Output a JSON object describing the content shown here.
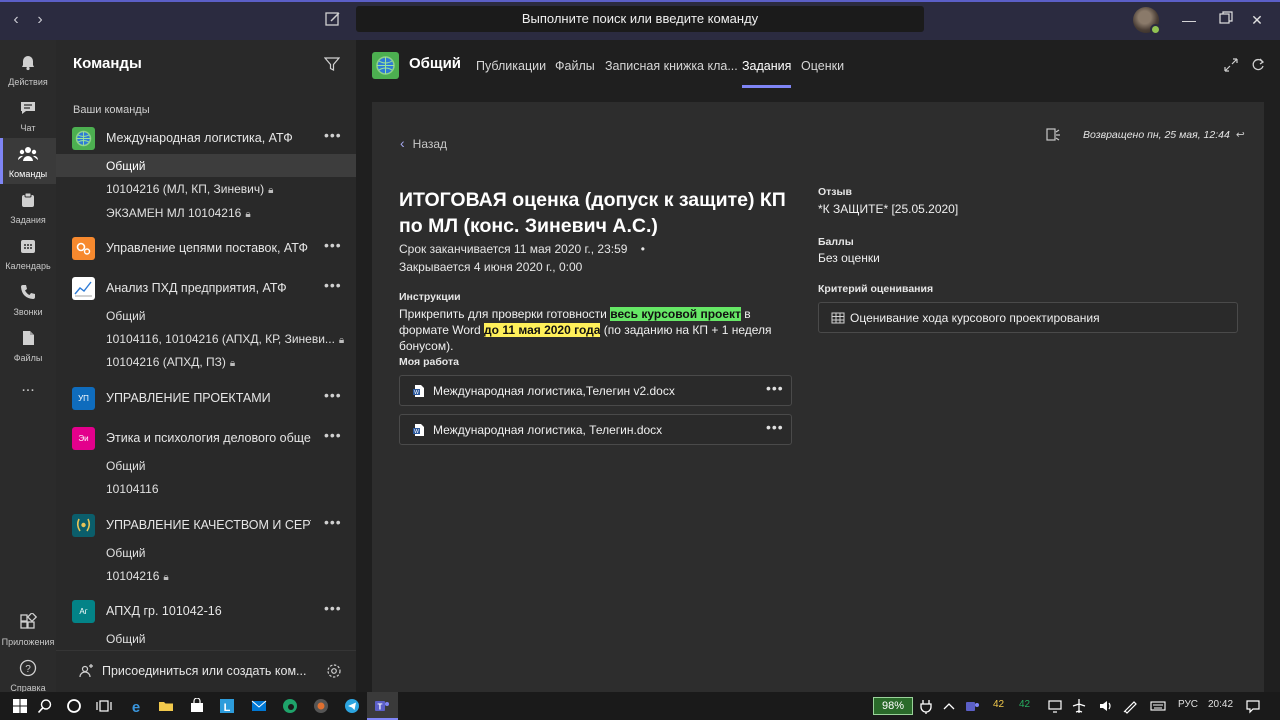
{
  "titlebar": {
    "search_placeholder": "Выполните поиск или введите команду",
    "back_icon": "chevron-left-icon",
    "forward_icon": "chevron-right-icon"
  },
  "rail": {
    "items": [
      {
        "label": "Действия",
        "icon": "bell-icon"
      },
      {
        "label": "Чат",
        "icon": "chat-icon"
      },
      {
        "label": "Команды",
        "icon": "teams-icon"
      },
      {
        "label": "Задания",
        "icon": "assignments-icon"
      },
      {
        "label": "Календарь",
        "icon": "calendar-icon"
      },
      {
        "label": "Звонки",
        "icon": "phone-icon"
      },
      {
        "label": "Файлы",
        "icon": "files-icon"
      },
      {
        "label": "Приложения",
        "icon": "apps-icon"
      },
      {
        "label": "Справка",
        "icon": "help-icon"
      }
    ],
    "more": "..."
  },
  "teams_panel": {
    "title": "Команды",
    "section": "Ваши команды",
    "teams": [
      {
        "name": "Международная логистика, АТФ",
        "icon_text": "",
        "color": "#4caf50",
        "channels": [
          {
            "name": "Общий",
            "locked": false,
            "active": true
          },
          {
            "name": "10104216 (МЛ, КП, Зиневич)",
            "locked": true
          },
          {
            "name": "ЭКЗАМЕН МЛ 10104216",
            "locked": true
          }
        ]
      },
      {
        "name": "Управление цепями поставок, АТФ",
        "icon_text": "",
        "color": "#f7892e",
        "channels": []
      },
      {
        "name": "Анализ ПХД предприятия, АТФ",
        "icon_text": "",
        "color": "#ffffff",
        "channels": [
          {
            "name": "Общий",
            "locked": false
          },
          {
            "name": "10104116, 10104216 (АПХД, КР, Зиневи...",
            "locked": true
          },
          {
            "name": "10104216 (АПХД, ПЗ)",
            "locked": true
          }
        ]
      },
      {
        "name": "УПРАВЛЕНИЕ ПРОЕКТАМИ",
        "icon_text": "УП",
        "color": "#0f6cbd",
        "channels": []
      },
      {
        "name": "Этика и психология делового обще...",
        "icon_text": "Эи",
        "color": "#e3008c",
        "channels": [
          {
            "name": "Общий",
            "locked": false
          },
          {
            "name": "10104116",
            "locked": false
          }
        ]
      },
      {
        "name": "УПРАВЛЕНИЕ КАЧЕСТВОМ И СЕРТИ...",
        "icon_text": "",
        "color": "#0b5e6b",
        "channels": [
          {
            "name": "Общий",
            "locked": false
          },
          {
            "name": "10104216",
            "locked": true
          }
        ]
      },
      {
        "name": "АПХД гр. 101042-16",
        "icon_text": "Аг",
        "color": "#038387",
        "channels": [
          {
            "name": "Общий",
            "locked": false
          }
        ]
      }
    ],
    "more": "•••",
    "lock": "🔒",
    "join_label": "Присоединиться или создать ком..."
  },
  "channel_header": {
    "title": "Общий",
    "tabs": [
      {
        "label": "Публикации",
        "active": false
      },
      {
        "label": "Файлы",
        "active": false
      },
      {
        "label": "Записная книжка кла...",
        "active": false
      },
      {
        "label": "Задания",
        "active": true
      },
      {
        "label": "Оценки",
        "active": false
      }
    ]
  },
  "assignment": {
    "back_label": "Назад",
    "returned": "Возвращено пн, 25 мая, 12:44",
    "title": "ИТОГОВАЯ оценка (допуск к защите) КП по МЛ (конс. Зиневич А.С.)",
    "due": "Срок заканчивается 11 мая 2020 г., 23:59",
    "closes": "Закрывается 4 июня 2020 г., 0:00",
    "instructions_label": "Инструкции",
    "instructions": {
      "part1": "Прикрепить для проверки готовности ",
      "hl1": "весь курсовой проект",
      "part2": " в формате Word ",
      "hl2": "до 11 мая 2020 года",
      "part3": " (по заданию на КП + 1 неделя бонусом)."
    },
    "my_work_label": "Моя работа",
    "files": [
      {
        "name": "Международная логистика,Телегин v2.docx"
      },
      {
        "name": "Международная логистика, Телегин.docx"
      }
    ],
    "feedback_label": "Отзыв",
    "feedback": "*К ЗАЩИТЕ* [25.05.2020]",
    "points_label": "Баллы",
    "points": "Без оценки",
    "rubric_label": "Критерий оценивания",
    "rubric": "Оценивание хода курсового проектирования"
  },
  "taskbar": {
    "battery": "98%",
    "badge1": "42",
    "badge2": "42",
    "lang": "РУС",
    "time": "20:42"
  }
}
